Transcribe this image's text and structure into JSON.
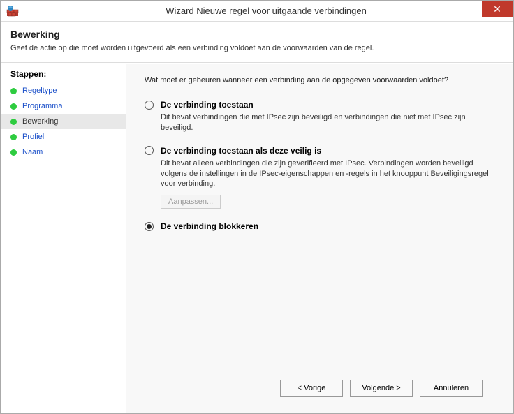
{
  "window": {
    "title": "Wizard Nieuwe regel voor uitgaande verbindingen"
  },
  "header": {
    "title": "Bewerking",
    "subtitle": "Geef de actie op die moet worden uitgevoerd als een verbinding voldoet aan de voorwaarden van de regel."
  },
  "sidebar": {
    "title": "Stappen:",
    "items": [
      {
        "label": "Regeltype"
      },
      {
        "label": "Programma"
      },
      {
        "label": "Bewerking"
      },
      {
        "label": "Profiel"
      },
      {
        "label": "Naam"
      }
    ]
  },
  "content": {
    "question": "Wat moet er gebeuren wanneer een verbinding aan de opgegeven voorwaarden voldoet?",
    "options": [
      {
        "label": "De verbinding toestaan",
        "description": "Dit bevat verbindingen die met IPsec zijn beveiligd en verbindingen die niet met IPsec zijn beveiligd."
      },
      {
        "label": "De verbinding toestaan als deze veilig is",
        "description": "Dit bevat alleen verbindingen die zijn geverifieerd met IPsec. Verbindingen worden beveiligd volgens de instellingen in de IPsec-eigenschappen en -regels in het knooppunt Beveiligingsregel voor verbinding.",
        "customize": "Aanpassen..."
      },
      {
        "label": "De verbinding blokkeren"
      }
    ]
  },
  "footer": {
    "back": "< Vorige",
    "next": "Volgende >",
    "cancel": "Annuleren"
  }
}
